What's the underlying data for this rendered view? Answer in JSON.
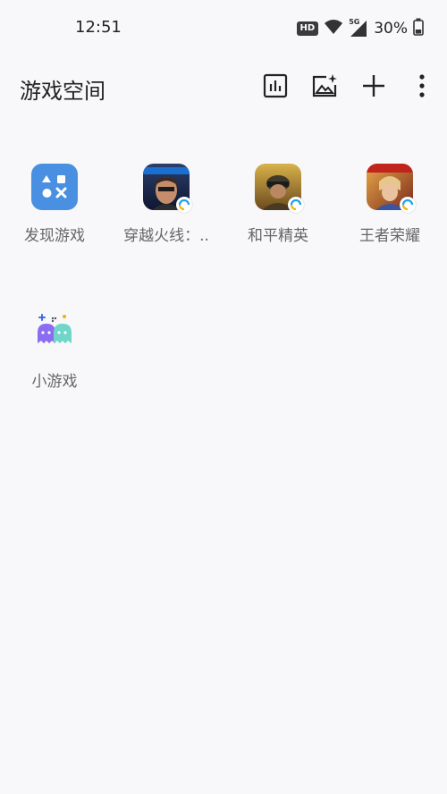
{
  "status_bar": {
    "time": "12:51",
    "hd_label": "HD",
    "network_label": "5G",
    "battery_text": "30%"
  },
  "header": {
    "title": "游戏空间"
  },
  "apps": [
    {
      "label": "发现游戏",
      "icon": "discover-games-icon"
    },
    {
      "label": "穿越火线：..",
      "icon": "crossfire-game-icon"
    },
    {
      "label": "和平精英",
      "icon": "peacekeeper-elite-game-icon"
    },
    {
      "label": "王者荣耀",
      "icon": "honor-of-kings-game-icon"
    },
    {
      "label": "小游戏",
      "icon": "mini-games-icon"
    }
  ],
  "colors": {
    "background": "#f8f8fa",
    "discover_icon_bg": "#4a90e2",
    "mini_ghost_purple": "#8a6df0",
    "mini_ghost_teal": "#6fd6c9"
  }
}
